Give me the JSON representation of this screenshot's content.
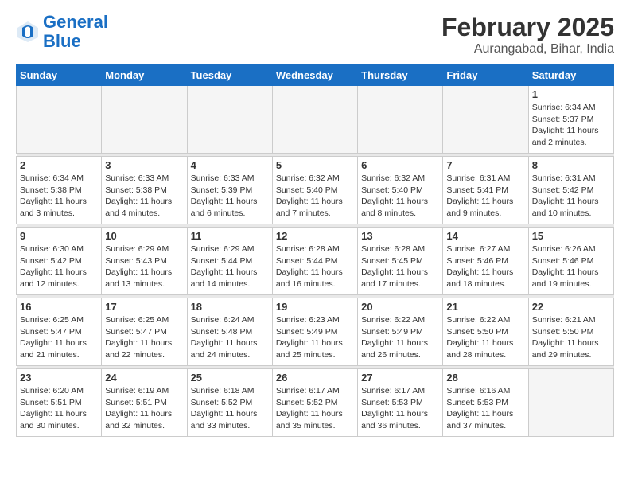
{
  "header": {
    "logo_line1": "General",
    "logo_line2": "Blue",
    "main_title": "February 2025",
    "subtitle": "Aurangabad, Bihar, India"
  },
  "days_of_week": [
    "Sunday",
    "Monday",
    "Tuesday",
    "Wednesday",
    "Thursday",
    "Friday",
    "Saturday"
  ],
  "weeks": [
    [
      {
        "day": "",
        "info": ""
      },
      {
        "day": "",
        "info": ""
      },
      {
        "day": "",
        "info": ""
      },
      {
        "day": "",
        "info": ""
      },
      {
        "day": "",
        "info": ""
      },
      {
        "day": "",
        "info": ""
      },
      {
        "day": "1",
        "info": "Sunrise: 6:34 AM\nSunset: 5:37 PM\nDaylight: 11 hours and 2 minutes."
      }
    ],
    [
      {
        "day": "2",
        "info": "Sunrise: 6:34 AM\nSunset: 5:38 PM\nDaylight: 11 hours and 3 minutes."
      },
      {
        "day": "3",
        "info": "Sunrise: 6:33 AM\nSunset: 5:38 PM\nDaylight: 11 hours and 4 minutes."
      },
      {
        "day": "4",
        "info": "Sunrise: 6:33 AM\nSunset: 5:39 PM\nDaylight: 11 hours and 6 minutes."
      },
      {
        "day": "5",
        "info": "Sunrise: 6:32 AM\nSunset: 5:40 PM\nDaylight: 11 hours and 7 minutes."
      },
      {
        "day": "6",
        "info": "Sunrise: 6:32 AM\nSunset: 5:40 PM\nDaylight: 11 hours and 8 minutes."
      },
      {
        "day": "7",
        "info": "Sunrise: 6:31 AM\nSunset: 5:41 PM\nDaylight: 11 hours and 9 minutes."
      },
      {
        "day": "8",
        "info": "Sunrise: 6:31 AM\nSunset: 5:42 PM\nDaylight: 11 hours and 10 minutes."
      }
    ],
    [
      {
        "day": "9",
        "info": "Sunrise: 6:30 AM\nSunset: 5:42 PM\nDaylight: 11 hours and 12 minutes."
      },
      {
        "day": "10",
        "info": "Sunrise: 6:29 AM\nSunset: 5:43 PM\nDaylight: 11 hours and 13 minutes."
      },
      {
        "day": "11",
        "info": "Sunrise: 6:29 AM\nSunset: 5:44 PM\nDaylight: 11 hours and 14 minutes."
      },
      {
        "day": "12",
        "info": "Sunrise: 6:28 AM\nSunset: 5:44 PM\nDaylight: 11 hours and 16 minutes."
      },
      {
        "day": "13",
        "info": "Sunrise: 6:28 AM\nSunset: 5:45 PM\nDaylight: 11 hours and 17 minutes."
      },
      {
        "day": "14",
        "info": "Sunrise: 6:27 AM\nSunset: 5:46 PM\nDaylight: 11 hours and 18 minutes."
      },
      {
        "day": "15",
        "info": "Sunrise: 6:26 AM\nSunset: 5:46 PM\nDaylight: 11 hours and 19 minutes."
      }
    ],
    [
      {
        "day": "16",
        "info": "Sunrise: 6:25 AM\nSunset: 5:47 PM\nDaylight: 11 hours and 21 minutes."
      },
      {
        "day": "17",
        "info": "Sunrise: 6:25 AM\nSunset: 5:47 PM\nDaylight: 11 hours and 22 minutes."
      },
      {
        "day": "18",
        "info": "Sunrise: 6:24 AM\nSunset: 5:48 PM\nDaylight: 11 hours and 24 minutes."
      },
      {
        "day": "19",
        "info": "Sunrise: 6:23 AM\nSunset: 5:49 PM\nDaylight: 11 hours and 25 minutes."
      },
      {
        "day": "20",
        "info": "Sunrise: 6:22 AM\nSunset: 5:49 PM\nDaylight: 11 hours and 26 minutes."
      },
      {
        "day": "21",
        "info": "Sunrise: 6:22 AM\nSunset: 5:50 PM\nDaylight: 11 hours and 28 minutes."
      },
      {
        "day": "22",
        "info": "Sunrise: 6:21 AM\nSunset: 5:50 PM\nDaylight: 11 hours and 29 minutes."
      }
    ],
    [
      {
        "day": "23",
        "info": "Sunrise: 6:20 AM\nSunset: 5:51 PM\nDaylight: 11 hours and 30 minutes."
      },
      {
        "day": "24",
        "info": "Sunrise: 6:19 AM\nSunset: 5:51 PM\nDaylight: 11 hours and 32 minutes."
      },
      {
        "day": "25",
        "info": "Sunrise: 6:18 AM\nSunset: 5:52 PM\nDaylight: 11 hours and 33 minutes."
      },
      {
        "day": "26",
        "info": "Sunrise: 6:17 AM\nSunset: 5:52 PM\nDaylight: 11 hours and 35 minutes."
      },
      {
        "day": "27",
        "info": "Sunrise: 6:17 AM\nSunset: 5:53 PM\nDaylight: 11 hours and 36 minutes."
      },
      {
        "day": "28",
        "info": "Sunrise: 6:16 AM\nSunset: 5:53 PM\nDaylight: 11 hours and 37 minutes."
      },
      {
        "day": "",
        "info": ""
      }
    ]
  ]
}
